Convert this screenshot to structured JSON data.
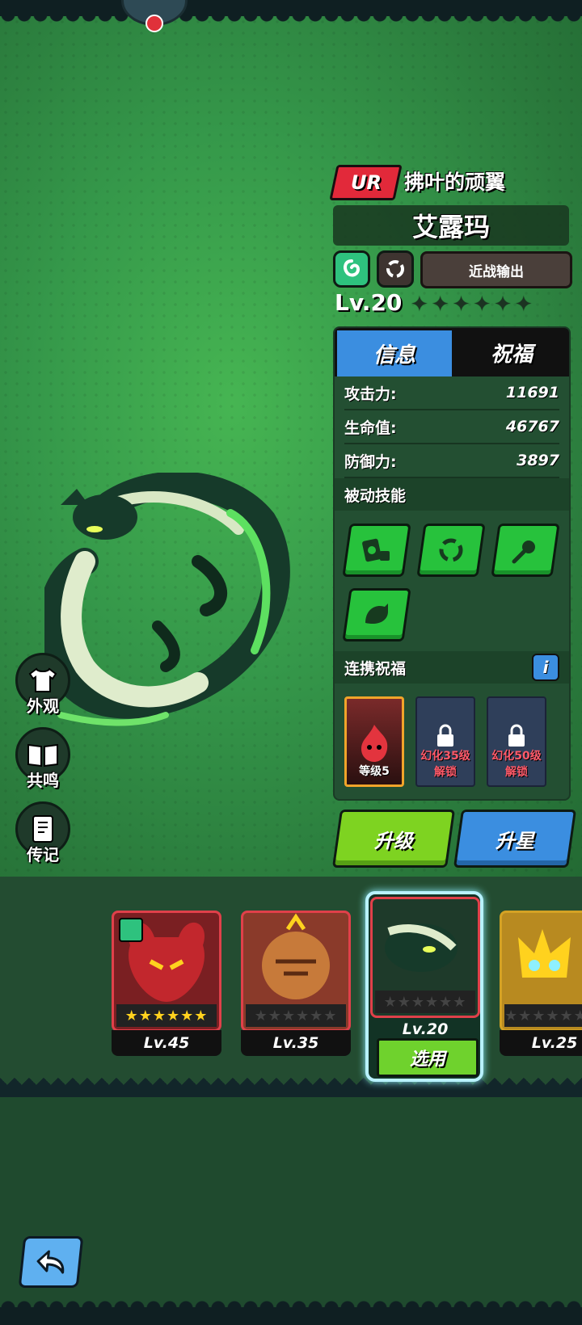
{
  "hero": {
    "rarity": "UR",
    "subtitle": "拂叶的顽翼",
    "name": "艾露玛",
    "role": "近战输出",
    "level": "Lv.20",
    "stars_filled": 0,
    "stars_total": 6
  },
  "side_menu": [
    {
      "label": "外观",
      "icon": "shirt-icon"
    },
    {
      "label": "共鸣",
      "icon": "book-icon"
    },
    {
      "label": "传记",
      "icon": "journal-icon"
    }
  ],
  "tabs": [
    {
      "label": "信息",
      "active": true
    },
    {
      "label": "祝福",
      "active": false
    }
  ],
  "stats": [
    {
      "label": "攻击力:",
      "value": "11691"
    },
    {
      "label": "生命值:",
      "value": "46767"
    },
    {
      "label": "防御力:",
      "value": "3897"
    }
  ],
  "passive": {
    "title": "被动技能",
    "skills": [
      "card-dice-icon",
      "swirl-icon",
      "dash-orb-icon",
      "beast-icon"
    ]
  },
  "bless": {
    "title": "连携祝福",
    "info": "i",
    "slots": [
      {
        "label": "等级5",
        "locked": false
      },
      {
        "label": "幻化35级",
        "sub": "解锁",
        "locked": true
      },
      {
        "label": "幻化50级",
        "sub": "解锁",
        "locked": true
      }
    ]
  },
  "actions": {
    "upgrade": "升级",
    "star_up": "升星"
  },
  "roster": [
    {
      "level": "Lv.45",
      "stars": 6,
      "color": "#7a1f22"
    },
    {
      "level": "Lv.35",
      "stars": 0,
      "color": "#8a3a2a"
    },
    {
      "level": "Lv.20",
      "stars": 0,
      "color": "#1e3a2a",
      "selected": true
    },
    {
      "level": "Lv.25",
      "stars": 0,
      "color": "#b88a20"
    }
  ],
  "select_label": "选用",
  "colors": {
    "rarity_red": "#e2293a",
    "tab_blue": "#3b8ee0",
    "upgrade_green": "#7ed321",
    "starup_blue": "#3b8ee0",
    "select_frame": "#b8f2ff"
  }
}
